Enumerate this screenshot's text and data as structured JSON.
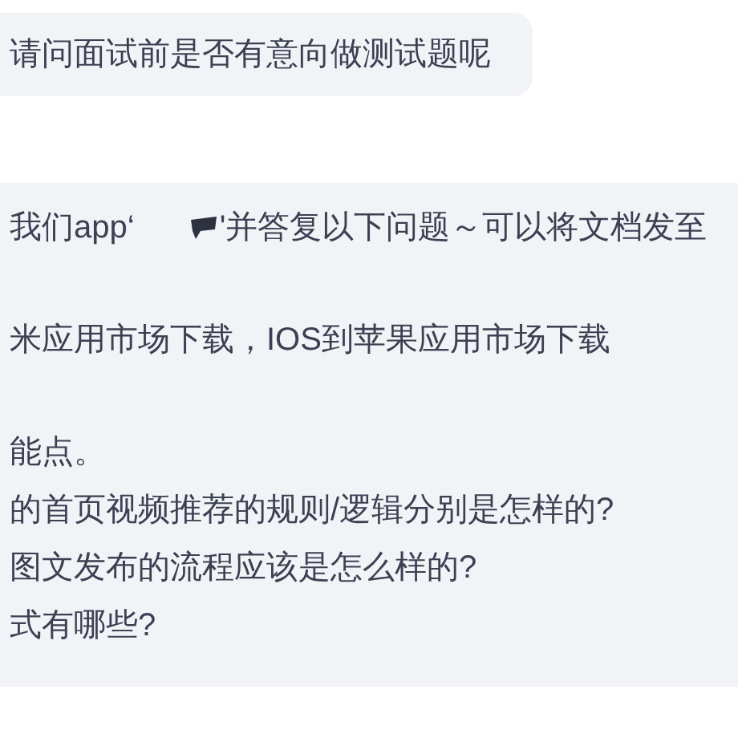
{
  "messages": [
    {
      "kind": "plain",
      "paragraphs": [
        [
          "请问面试前是否有意向做测试题呢"
        ]
      ]
    },
    {
      "kind": "wide",
      "paragraphs": [
        [
          {
            "before": "我们app‘",
            "after": "'并答复以下问题～可以将文档发至"
          }
        ],
        [
          "米应用市场下载，IOS到苹果应用市场下载"
        ],
        [
          "能点。",
          "的首页视频推荐的规则/逻辑分别是怎样的?",
          "图文发布的流程应该是怎么样的?",
          "式有哪些?"
        ]
      ]
    }
  ]
}
